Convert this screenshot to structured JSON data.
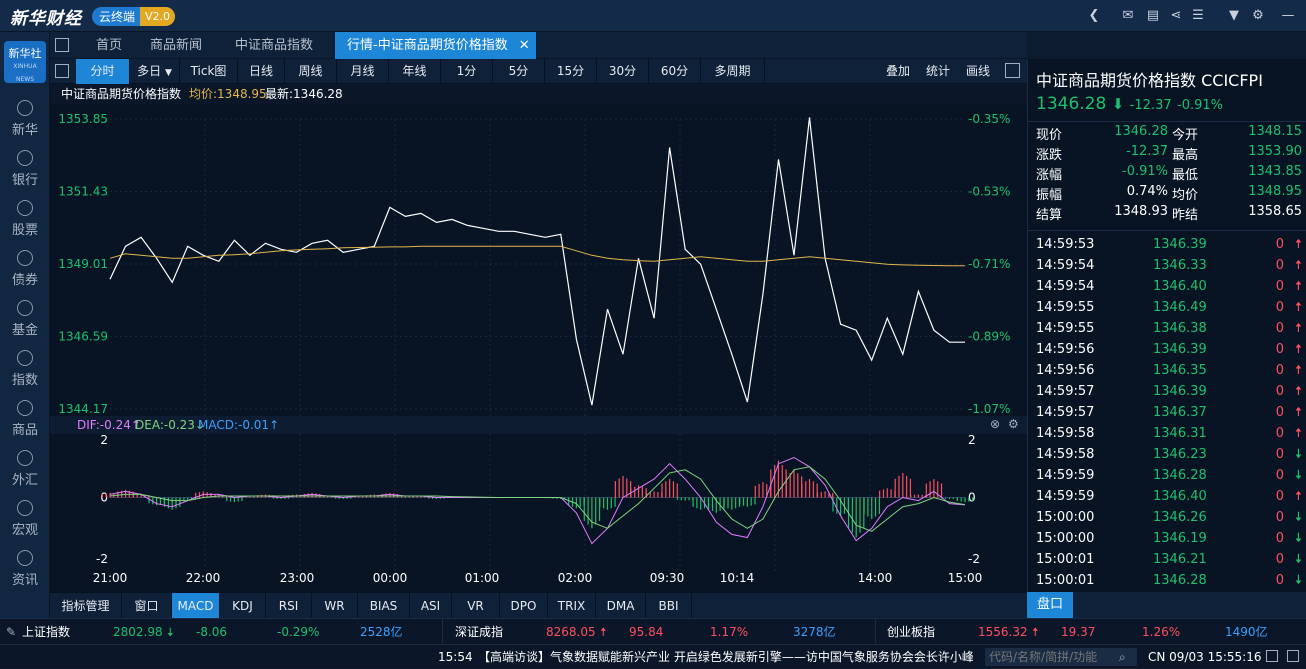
{
  "app": {
    "logo": "新华财经",
    "cloud": "云终端",
    "version": "V2.0"
  },
  "title_icons": [
    "back-icon",
    "mail-icon",
    "chat-icon",
    "share-icon",
    "list-icon",
    "shirt-icon",
    "gear-icon",
    "minimize-icon"
  ],
  "leftnav": {
    "logo_main": "新华社",
    "logo_sub": "XINHUA NEWS",
    "items": [
      "新华",
      "银行",
      "股票",
      "债券",
      "基金",
      "指数",
      "商品",
      "外汇",
      "宏观",
      "资讯"
    ]
  },
  "tabs": [
    "首页",
    "商品新闻",
    "中证商品指数",
    "行情-中证商品期货价格指数"
  ],
  "periods": [
    "分时",
    "多日",
    "Tick图",
    "日线",
    "周线",
    "月线",
    "年线",
    "1分",
    "5分",
    "15分",
    "30分",
    "60分",
    "多周期"
  ],
  "right_tools": [
    "叠加",
    "统计",
    "画线"
  ],
  "chart_head": {
    "name": "中证商品期货价格指数",
    "avg_label": "均价:1348.95",
    "last_label": "最新:1346.28"
  },
  "macd_head": {
    "dif": "DIF:-0.24↑",
    "dea": "DEA:-0.23↓",
    "macd": "MACD:-0.01↑"
  },
  "chart_data": {
    "type": "line",
    "title": "中证商品期货价格指数",
    "y_ticks": [
      "1353.85",
      "1351.43",
      "1349.01",
      "1346.59",
      "1344.17"
    ],
    "pct_ticks": [
      "-0.35%",
      "-0.53%",
      "-0.71%",
      "-0.89%",
      "-1.07%"
    ],
    "ylim": [
      1344.17,
      1353.85
    ],
    "x_ticks": [
      "21:00",
      "22:00",
      "23:00",
      "00:00",
      "01:00",
      "02:00",
      "09:30",
      "10:14",
      "14:00",
      "15:00"
    ],
    "series": [
      {
        "name": "price",
        "values": [
          1348.5,
          1349.6,
          1349.9,
          1349.2,
          1348.4,
          1349.6,
          1349.3,
          1349.1,
          1349.8,
          1349.3,
          1349.7,
          1349.5,
          1349.4,
          1349.7,
          1349.8,
          1349.4,
          1349.5,
          1349.6,
          1350.9,
          1350.6,
          1350.7,
          1350.4,
          1350.5,
          1350.3,
          1350.2,
          1350.1,
          1350.1,
          1350.0,
          1349.9,
          1350.0,
          1346.5,
          1344.3,
          1347.5,
          1346.0,
          1349.2,
          1347.2,
          1352.9,
          1349.5,
          1349.0,
          1347.5,
          1346.0,
          1344.4,
          1348.0,
          1352.5,
          1349.3,
          1353.9,
          1349.2,
          1347.0,
          1346.8,
          1345.8,
          1347.2,
          1346.0,
          1348.1,
          1346.8,
          1346.4,
          1346.4
        ]
      },
      {
        "name": "avg",
        "values": [
          1349.2,
          1349.35,
          1349.3,
          1349.25,
          1349.2,
          1349.2,
          1349.25,
          1349.3,
          1349.32,
          1349.35,
          1349.4,
          1349.45,
          1349.48,
          1349.5,
          1349.52,
          1349.55,
          1349.56,
          1349.57,
          1349.58,
          1349.58,
          1349.6,
          1349.6,
          1349.6,
          1349.6,
          1349.6,
          1349.6,
          1349.6,
          1349.6,
          1349.6,
          1349.6,
          1349.45,
          1349.3,
          1349.2,
          1349.15,
          1349.12,
          1349.1,
          1349.15,
          1349.2,
          1349.25,
          1349.2,
          1349.15,
          1349.1,
          1349.1,
          1349.15,
          1349.2,
          1349.25,
          1349.2,
          1349.15,
          1349.1,
          1349.05,
          1349.0,
          1348.98,
          1348.97,
          1348.96,
          1348.95,
          1348.95
        ]
      }
    ],
    "macd_ticks": [
      "2",
      "0",
      "-2"
    ],
    "macd_ylim": [
      -2,
      2
    ],
    "macd_hist": [
      0.15,
      0.25,
      0.1,
      -0.25,
      -0.4,
      -0.1,
      0.2,
      0.1,
      -0.15,
      0.05,
      0.1,
      -0.05,
      0.1,
      0.15,
      0.05,
      -0.05,
      0.05,
      0.1,
      0.15,
      0.05,
      0.05,
      -0.05,
      0.02,
      -0.02,
      0.02,
      -0.02,
      0.0,
      0.0,
      0.0,
      -0.05,
      -0.35,
      -1.0,
      -0.4,
      0.7,
      0.4,
      0.2,
      0.6,
      -0.1,
      -0.4,
      -0.5,
      -0.4,
      -0.3,
      0.5,
      1.2,
      0.9,
      0.6,
      0.2,
      -0.6,
      -1.3,
      -0.7,
      0.3,
      0.8,
      0.1,
      0.6,
      -0.05,
      -0.15
    ],
    "dif": [
      0.1,
      0.2,
      0.1,
      -0.2,
      -0.3,
      -0.1,
      0.1,
      0.1,
      0.0,
      0.05,
      0.05,
      0.0,
      0.05,
      0.1,
      0.05,
      0.0,
      0.05,
      0.05,
      0.1,
      0.05,
      0.05,
      0.0,
      0.0,
      0.0,
      0.0,
      0.0,
      0.0,
      0.0,
      0.0,
      0.0,
      -0.5,
      -1.5,
      -1.0,
      0.0,
      0.3,
      0.6,
      1.1,
      0.6,
      0.0,
      -0.8,
      -1.2,
      -1.3,
      -0.3,
      1.1,
      1.3,
      1.0,
      0.4,
      -0.6,
      -1.4,
      -1.0,
      -0.3,
      0.0,
      -0.1,
      0.2,
      -0.2,
      -0.24
    ],
    "dea": [
      0.05,
      0.1,
      0.1,
      0.0,
      -0.1,
      -0.1,
      0.0,
      0.05,
      0.05,
      0.05,
      0.05,
      0.05,
      0.05,
      0.05,
      0.05,
      0.05,
      0.05,
      0.05,
      0.05,
      0.05,
      0.05,
      0.05,
      0.03,
      0.02,
      0.01,
      0.0,
      0.0,
      0.0,
      0.0,
      0.0,
      -0.2,
      -0.8,
      -1.0,
      -0.6,
      -0.2,
      0.3,
      0.8,
      0.9,
      0.6,
      -0.1,
      -0.7,
      -1.0,
      -0.7,
      0.2,
      0.9,
      1.0,
      0.6,
      -0.1,
      -0.9,
      -1.1,
      -0.7,
      -0.3,
      -0.2,
      0.0,
      -0.15,
      -0.23
    ]
  },
  "right_panel": {
    "title": "中证商品期货价格指数",
    "code": "CCICFPI",
    "price": "1346.28",
    "change": "-12.37",
    "pct": "-0.91%",
    "stats": [
      {
        "l1": "现价",
        "v1": "1346.28",
        "c1": "dn",
        "l2": "今开",
        "v2": "1348.15",
        "c2": "dn"
      },
      {
        "l1": "涨跌",
        "v1": "-12.37",
        "c1": "dn",
        "l2": "最高",
        "v2": "1353.90",
        "c2": "dn"
      },
      {
        "l1": "涨幅",
        "v1": "-0.91%",
        "c1": "dn",
        "l2": "最低",
        "v2": "1343.85",
        "c2": "dn"
      },
      {
        "l1": "振幅",
        "v1": "0.74%",
        "c1": "white",
        "l2": "均价",
        "v2": "1348.95",
        "c2": "dn"
      },
      {
        "l1": "结算",
        "v1": "1348.93",
        "c1": "white",
        "l2": "昨结",
        "v2": "1358.65",
        "c2": "white"
      }
    ],
    "ticks": [
      {
        "t": "14:59:53",
        "p": "1346.39",
        "v": "0",
        "d": "up"
      },
      {
        "t": "14:59:54",
        "p": "1346.33",
        "v": "0",
        "d": "up"
      },
      {
        "t": "14:59:54",
        "p": "1346.40",
        "v": "0",
        "d": "up"
      },
      {
        "t": "14:59:55",
        "p": "1346.49",
        "v": "0",
        "d": "up"
      },
      {
        "t": "14:59:55",
        "p": "1346.38",
        "v": "0",
        "d": "up"
      },
      {
        "t": "14:59:56",
        "p": "1346.39",
        "v": "0",
        "d": "up"
      },
      {
        "t": "14:59:56",
        "p": "1346.35",
        "v": "0",
        "d": "up"
      },
      {
        "t": "14:59:57",
        "p": "1346.39",
        "v": "0",
        "d": "up"
      },
      {
        "t": "14:59:57",
        "p": "1346.37",
        "v": "0",
        "d": "up"
      },
      {
        "t": "14:59:58",
        "p": "1346.31",
        "v": "0",
        "d": "up"
      },
      {
        "t": "14:59:58",
        "p": "1346.23",
        "v": "0",
        "d": "dn"
      },
      {
        "t": "14:59:59",
        "p": "1346.28",
        "v": "0",
        "d": "dn"
      },
      {
        "t": "14:59:59",
        "p": "1346.40",
        "v": "0",
        "d": "up"
      },
      {
        "t": "15:00:00",
        "p": "1346.26",
        "v": "0",
        "d": "dn"
      },
      {
        "t": "15:00:00",
        "p": "1346.19",
        "v": "0",
        "d": "dn"
      },
      {
        "t": "15:00:01",
        "p": "1346.21",
        "v": "0",
        "d": "dn"
      },
      {
        "t": "15:00:01",
        "p": "1346.28",
        "v": "0",
        "d": "dn"
      }
    ],
    "panel_btn": "盘口"
  },
  "indicators": [
    "指标管理",
    "窗口",
    "MACD",
    "KDJ",
    "RSI",
    "WR",
    "BIAS",
    "ASI",
    "VR",
    "DPO",
    "TRIX",
    "DMA",
    "BBI"
  ],
  "index_bar": [
    {
      "name": "上证指数",
      "val": "2802.98",
      "chg": "-8.06",
      "pct": "-0.29%",
      "amt": "2528亿",
      "dir": "dn"
    },
    {
      "name": "深证成指",
      "val": "8268.05",
      "chg": "95.84",
      "pct": "1.17%",
      "amt": "3278亿",
      "dir": "up"
    },
    {
      "name": "创业板指",
      "val": "1556.32",
      "chg": "19.37",
      "pct": "1.26%",
      "amt": "1490亿",
      "dir": "up"
    }
  ],
  "news": {
    "time": "15:54",
    "text": "【高端访谈】气象数据赋能新兴产业 开启绿色发展新引擎——访中国气象服务协会会长许小峰",
    "search_placeholder": "代码/名称/简拼/功能",
    "clock": "CN 09/03 15:55:16"
  },
  "colors": {
    "up": "#ff4f5e",
    "down": "#1ec06d",
    "accent": "#1d86d6",
    "avg": "#e3b64f",
    "dif": "#e37bff",
    "dea": "#7fd47f"
  }
}
